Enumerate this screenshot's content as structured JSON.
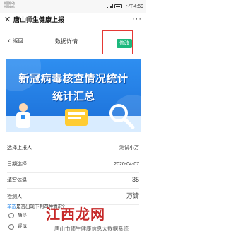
{
  "status_bar": {
    "carrier_lines": [
      "中国移动",
      "中国电信"
    ],
    "time": "下午4:59"
  },
  "app_header": {
    "close_glyph": "✕",
    "title": "唐山师生健康上报",
    "more_glyph": "···"
  },
  "page_nav": {
    "back_glyph": "‹",
    "back_label": "返回",
    "title": "数据详情",
    "edit_label": "修改"
  },
  "banner": {
    "title": "新冠病毒核查情况统计",
    "subtitle": "统计汇总",
    "colors": {
      "bg_top": "#2e8ef0",
      "bg_bottom": "#1b6fd8"
    }
  },
  "form": {
    "rows": [
      {
        "label": "选择上报人",
        "value": "测试小万"
      },
      {
        "label": "日期选择",
        "value": "2020-04-07"
      },
      {
        "label": "填写体温",
        "value": "35"
      },
      {
        "label": "检测人",
        "value": "万请"
      }
    ],
    "question": {
      "tag": "单选",
      "text": "是否出现下列四种情况?",
      "options": [
        "确诊",
        "疑似"
      ]
    }
  },
  "watermark": {
    "logo_text": "江西龙网",
    "caption": "唐山市师生健康信息大数据系统"
  },
  "colors": {
    "accent_green": "#1cb87d",
    "highlight_red": "#e53935",
    "primary_blue": "#2e8ef0"
  }
}
